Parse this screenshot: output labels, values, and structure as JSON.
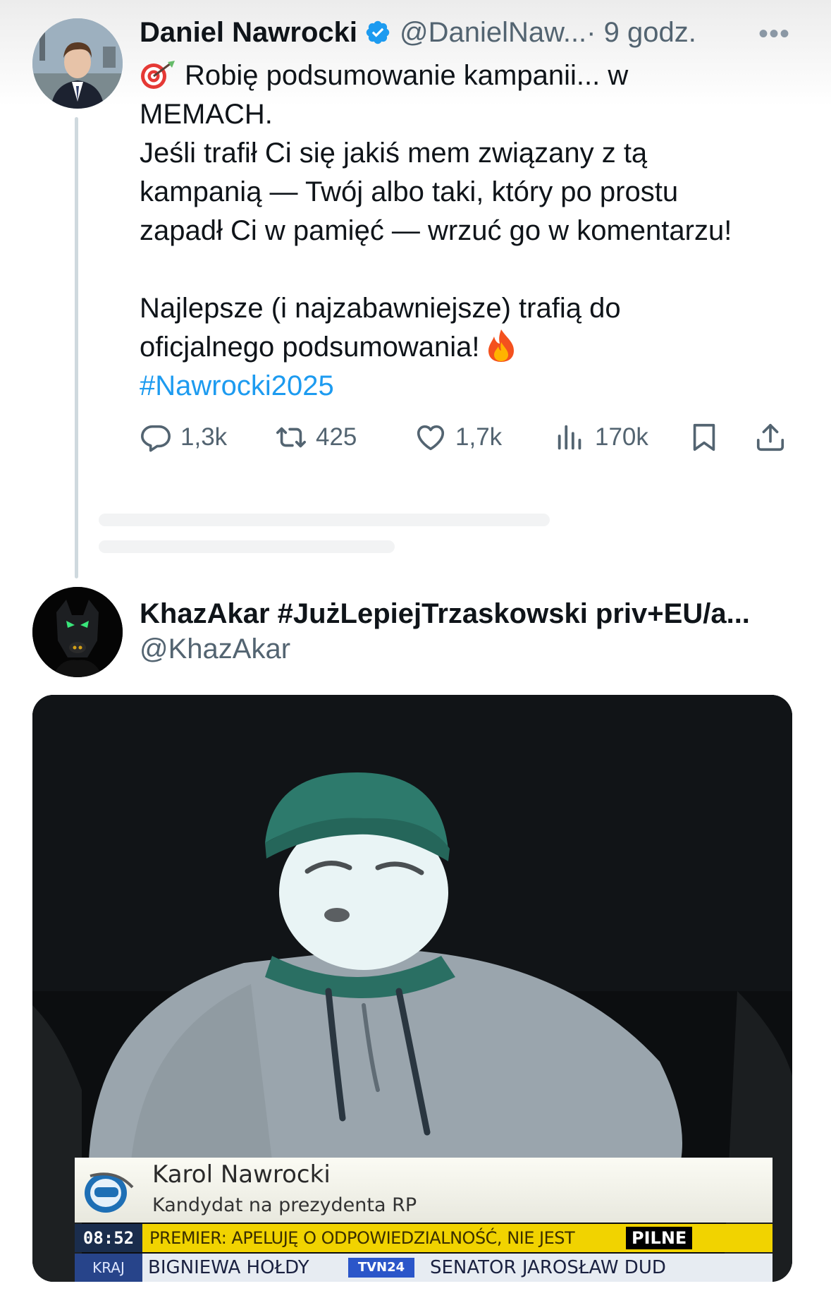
{
  "tweet1": {
    "author_name": "Daniel Nawrocki",
    "handle": "@DanielNaw...",
    "time": "· 9 godz.",
    "more": "•••",
    "text_lines": [
      "Robię podsumowanie kampanii... w",
      "MEMACH.",
      "Jeśli trafił Ci się jakiś mem związany z tą",
      "kampanią — Twój albo taki, który po prostu",
      "zapadł Ci w pamięć — wrzuć go w komentarzu!",
      "Najlepsze (i najzabawniejsze) trafią do",
      "oficjalnego podsumowania!"
    ],
    "hashtag": "#Nawrocki2025",
    "actions": {
      "replies": "1,3k",
      "reposts": "425",
      "likes": "1,7k",
      "views": "170k"
    },
    "icons": [
      "verified-badge-icon",
      "target-emoji-icon",
      "fire-emoji-icon",
      "reply-icon",
      "repost-icon",
      "like-icon",
      "views-icon",
      "bookmark-icon",
      "share-icon"
    ]
  },
  "tweet2": {
    "author_name": "KhazAkar #JużLepiejTrzaskowski priv+EU/a...",
    "handle": "@KhazAkar",
    "media": {
      "lower_third_name": "Karol Nawrocki",
      "lower_third_role": "Kandydat na prezydenta RP",
      "clock": "08:52",
      "ticker_text": "PREMIER: APELUJĘ O ODPOWIEDZIALNOŚĆ, NIE JEST",
      "pilne": "PILNE",
      "kraj": "KRAJ",
      "ticker2_a": "BIGNIEWA HOŁDY",
      "tvn24": "TVN24",
      "ticker2_b": "SENATOR JAROSŁAW DUD"
    }
  },
  "colors": {
    "link": "#1d9bf0",
    "secondary_text": "#536471",
    "primary_text": "#0f1419",
    "thread_line": "#cfd9de",
    "ticker_yellow": "#f1d300"
  }
}
